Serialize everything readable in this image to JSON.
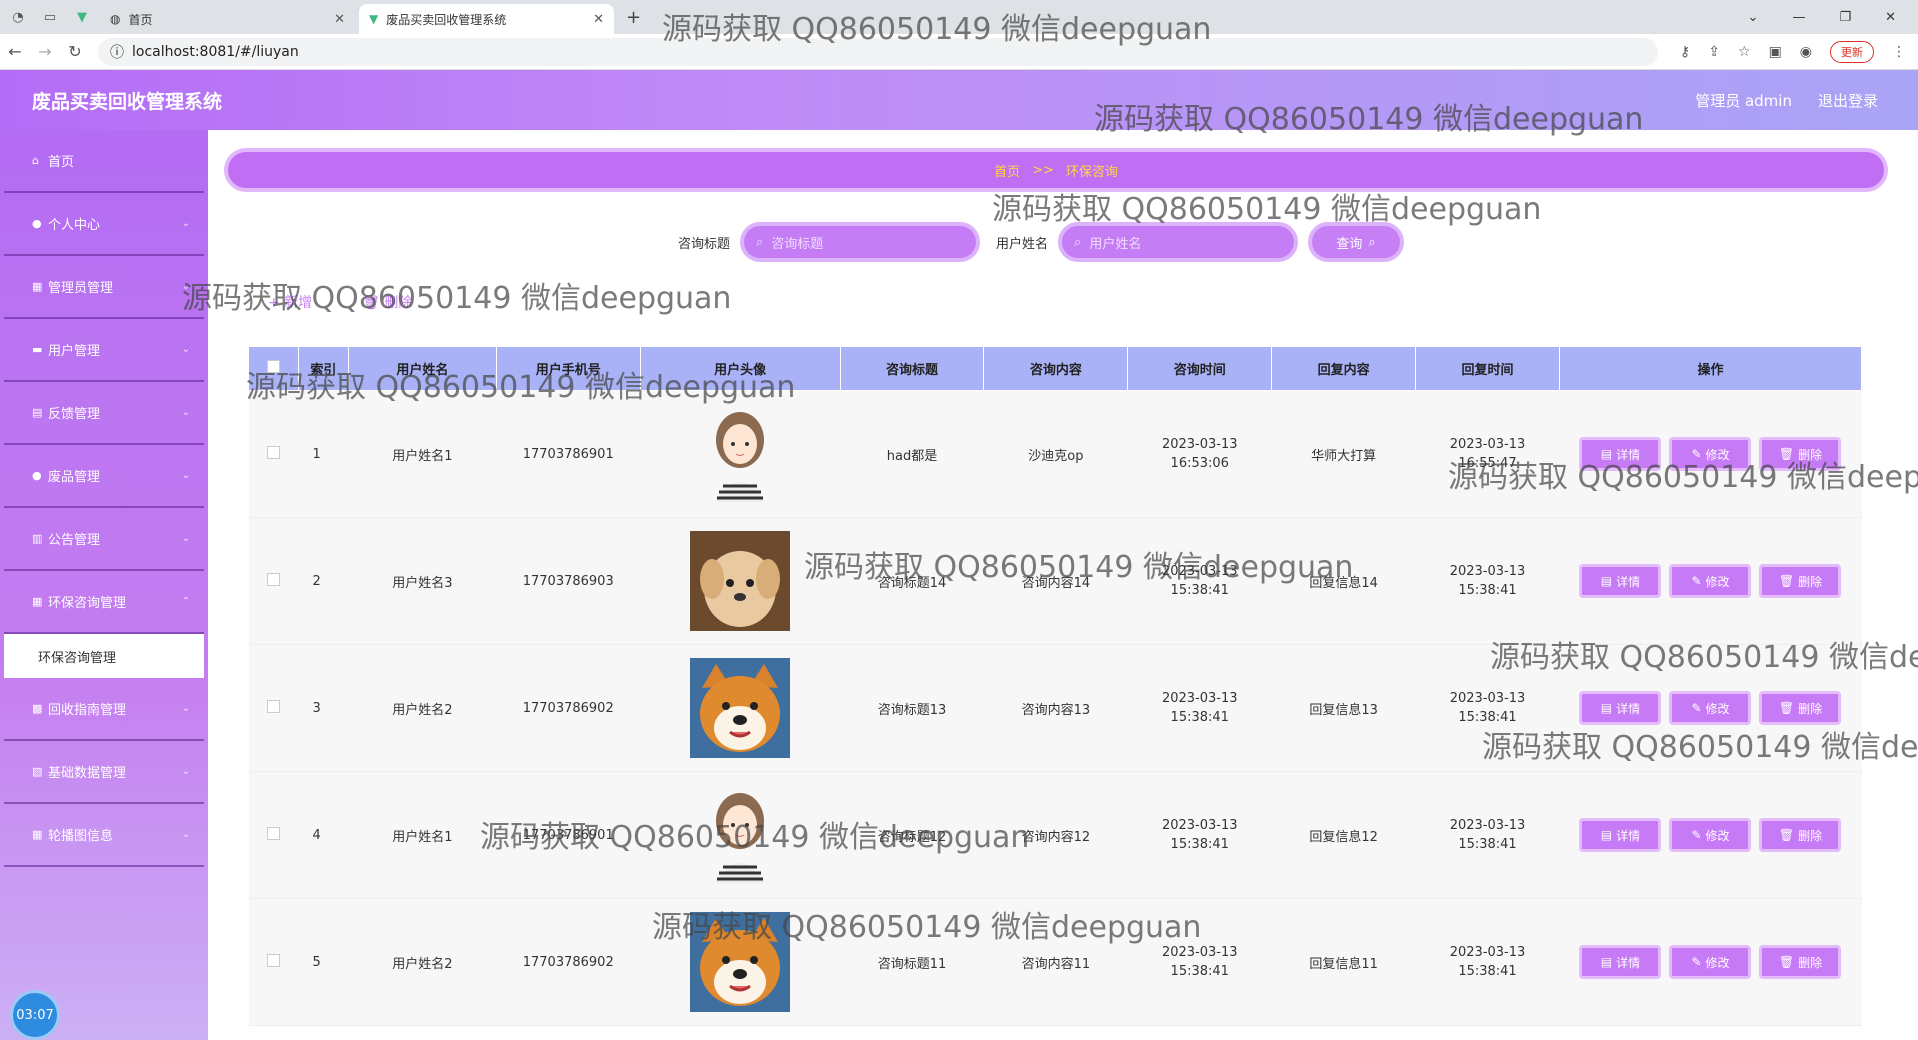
{
  "browser": {
    "tabs": [
      {
        "label": "首页"
      },
      {
        "label": "废品买卖回收管理系统"
      }
    ],
    "url": "localhost:8081/#/liuyan",
    "update_label": "更新"
  },
  "app": {
    "title": "废品买卖回收管理系统",
    "user_label": "管理员 admin",
    "logout_label": "退出登录"
  },
  "sidebar": {
    "items": [
      {
        "label": "首页"
      },
      {
        "label": "个人中心"
      },
      {
        "label": "管理员管理"
      },
      {
        "label": "用户管理"
      },
      {
        "label": "反馈管理"
      },
      {
        "label": "废品管理"
      },
      {
        "label": "公告管理"
      },
      {
        "label": "环保咨询管理"
      },
      {
        "label": "回收指南管理"
      },
      {
        "label": "基础数据管理"
      },
      {
        "label": "轮播图信息"
      }
    ],
    "submenu_label": "环保咨询管理",
    "timer": "03:07"
  },
  "breadcrumb": {
    "home": "首页",
    "sep": ">>",
    "current": "环保咨询"
  },
  "search": {
    "title_label": "咨询标题",
    "title_placeholder": "咨询标题",
    "name_label": "用户姓名",
    "name_placeholder": "用户姓名",
    "button": "查询"
  },
  "actions": {
    "add": "新增",
    "delete": "删除"
  },
  "table": {
    "headers": [
      "索引",
      "用户姓名",
      "用户手机号",
      "用户头像",
      "咨询标题",
      "咨询内容",
      "咨询时间",
      "回复内容",
      "回复时间",
      "操作"
    ],
    "rows": [
      {
        "idx": "1",
        "name": "用户姓名1",
        "phone": "17703786901",
        "avatar": "girl",
        "title": "had都是",
        "content": "沙迪克op",
        "time": "2023-03-13 16:53:06",
        "reply": "华师大打算",
        "reply_time": "2023-03-13 16:55:47"
      },
      {
        "idx": "2",
        "name": "用户姓名3",
        "phone": "17703786903",
        "avatar": "puppy",
        "title": "咨询标题14",
        "content": "咨询内容14",
        "time": "2023-03-13 15:38:41",
        "reply": "回复信息14",
        "reply_time": "2023-03-13 15:38:41"
      },
      {
        "idx": "3",
        "name": "用户姓名2",
        "phone": "17703786902",
        "avatar": "shiba",
        "title": "咨询标题13",
        "content": "咨询内容13",
        "time": "2023-03-13 15:38:41",
        "reply": "回复信息13",
        "reply_time": "2023-03-13 15:38:41"
      },
      {
        "idx": "4",
        "name": "用户姓名1",
        "phone": "17703786901",
        "avatar": "girl",
        "title": "咨询标题12",
        "content": "咨询内容12",
        "time": "2023-03-13 15:38:41",
        "reply": "回复信息12",
        "reply_time": "2023-03-13 15:38:41"
      },
      {
        "idx": "5",
        "name": "用户姓名2",
        "phone": "17703786902",
        "avatar": "shiba",
        "title": "咨询标题11",
        "content": "咨询内容11",
        "time": "2023-03-13 15:38:41",
        "reply": "回复信息11",
        "reply_time": "2023-03-13 15:38:41"
      }
    ],
    "op_labels": {
      "detail": "详情",
      "edit": "修改",
      "delete": "删除"
    }
  },
  "watermark": "源码获取 QQ86050149 微信deepguan"
}
